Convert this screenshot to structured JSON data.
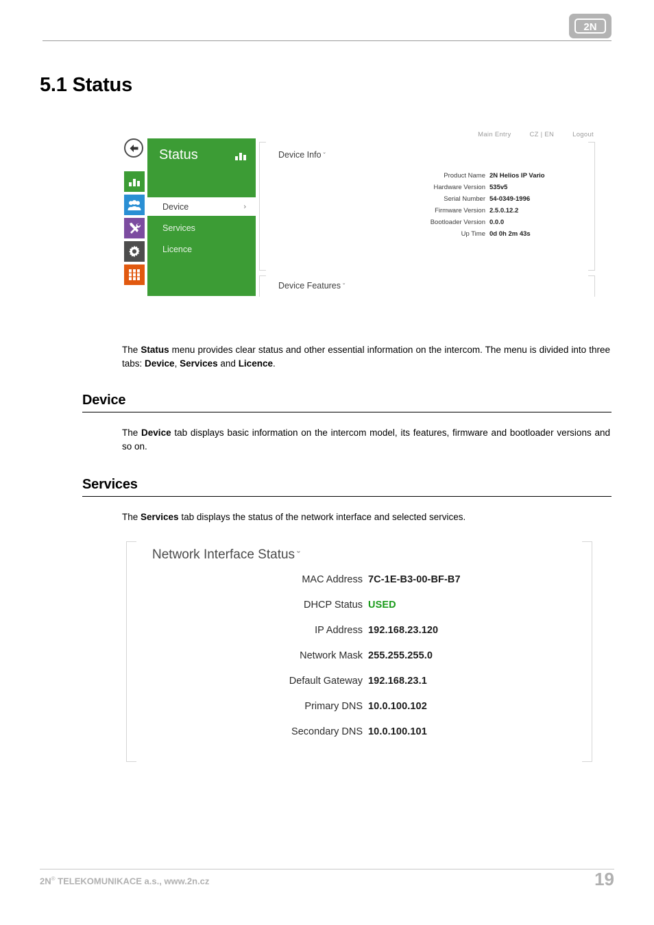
{
  "header": {
    "logo_text": "2N"
  },
  "chapter": {
    "title": "5.1 Status"
  },
  "screenshot_device": {
    "topnav": {
      "main_entry": "Main Entry",
      "language": "CZ | EN",
      "logout": "Logout"
    },
    "back_icon": "back-arrow-icon",
    "rail_icons": [
      "status-bar-chart-icon",
      "directory-users-icon",
      "hardware-tools-icon",
      "system-gear-icon",
      "applications-grid-icon"
    ],
    "menu": {
      "title": "Status",
      "title_icon": "bar-chart-icon",
      "items": [
        {
          "label": "Device",
          "active": true,
          "chevron": "›"
        },
        {
          "label": "Services",
          "active": false
        },
        {
          "label": "Licence",
          "active": false
        }
      ]
    },
    "device_info": {
      "title": "Device Info",
      "caret": "ˇ",
      "rows": [
        {
          "label": "Product Name",
          "value": "2N Helios IP Vario"
        },
        {
          "label": "Hardware Version",
          "value": "535v5"
        },
        {
          "label": "Serial Number",
          "value": "54-0349-1996"
        },
        {
          "label": "Firmware Version",
          "value": "2.5.0.12.2"
        },
        {
          "label": "Bootloader Version",
          "value": "0.0.0"
        },
        {
          "label": "Up Time",
          "value": "0d 0h 2m 43s"
        }
      ]
    },
    "device_features": {
      "title": "Device Features",
      "caret": "ˇ"
    }
  },
  "intro_paragraph": {
    "t1": "The ",
    "b1": "Status",
    "t2": " menu provides clear status and other essential information on the intercom. The menu is divided into three tabs: ",
    "b2": "Device",
    "t3": ", ",
    "b3": "Services",
    "t4": " and ",
    "b4": "Licence",
    "t5": "."
  },
  "section_device": {
    "heading": "Device",
    "paragraph": {
      "t1": "The ",
      "b1": "Device",
      "t2": " tab displays basic information on the intercom model, its features, firmware and bootloader versions and so on."
    }
  },
  "section_services": {
    "heading": "Services",
    "paragraph": {
      "t1": "The ",
      "b1": "Services",
      "t2": " tab displays the status of the network interface and selected services."
    }
  },
  "screenshot_network": {
    "title": "Network Interface Status",
    "caret": "ˇ",
    "rows": [
      {
        "label": "MAC Address",
        "value": "7C-1E-B3-00-BF-B7",
        "highlight": false
      },
      {
        "label": "DHCP Status",
        "value": "USED",
        "highlight": true
      },
      {
        "label": "IP Address",
        "value": "192.168.23.120",
        "highlight": false
      },
      {
        "label": "Network Mask",
        "value": "255.255.255.0",
        "highlight": false
      },
      {
        "label": "Default Gateway",
        "value": "192.168.23.1",
        "highlight": false
      },
      {
        "label": "Primary DNS",
        "value": "10.0.100.102",
        "highlight": false
      },
      {
        "label": "Secondary DNS",
        "value": "10.0.100.101",
        "highlight": false
      }
    ],
    "status_color": "#1a9b1a"
  },
  "footer": {
    "company": "2N",
    "registered": "®",
    "company_rest": " TELEKOMUNIKACE a.s., www.2n.cz",
    "page_number": "19"
  }
}
